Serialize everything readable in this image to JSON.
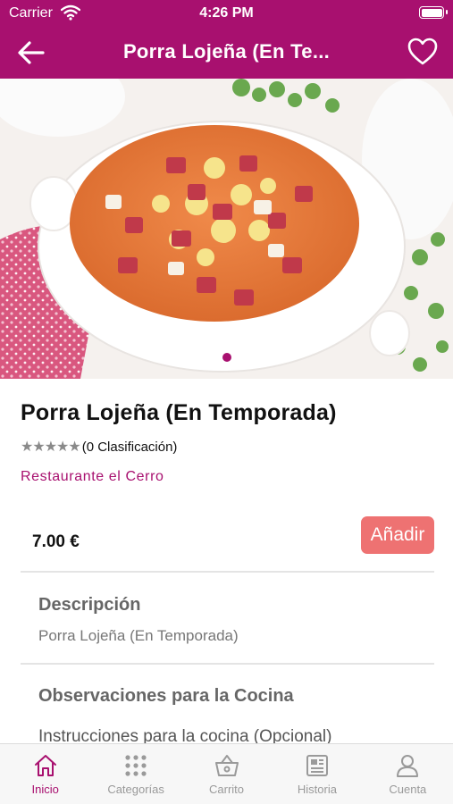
{
  "status_bar": {
    "carrier": "Carrier",
    "time": "4:26 PM"
  },
  "nav": {
    "title": "Porra Lojeña (En Te..."
  },
  "product": {
    "name": "Porra Lojeña (En Temporada)",
    "stars": "★★★★★",
    "rating_text": "(0 Clasificación)",
    "restaurant": "Restaurante el Cerro",
    "price": "7.00 €",
    "add_label": "Añadir"
  },
  "description": {
    "title": "Descripción",
    "text": "Porra Lojeña (En Temporada)"
  },
  "kitchen_notes": {
    "title": "Observaciones para la Cocina",
    "placeholder": "Instrucciones para la cocina (Opcional)"
  },
  "tabs": [
    {
      "label": "Inicio",
      "icon": "home-icon",
      "active": true
    },
    {
      "label": "Categorías",
      "icon": "grid-icon"
    },
    {
      "label": "Carrito",
      "icon": "basket-icon"
    },
    {
      "label": "Historia",
      "icon": "newspaper-icon"
    },
    {
      "label": "Cuenta",
      "icon": "person-icon"
    }
  ],
  "colors": {
    "brand": "#a8106f",
    "add_button": "#ee7272",
    "tab_inactive": "#9a9a9a"
  }
}
